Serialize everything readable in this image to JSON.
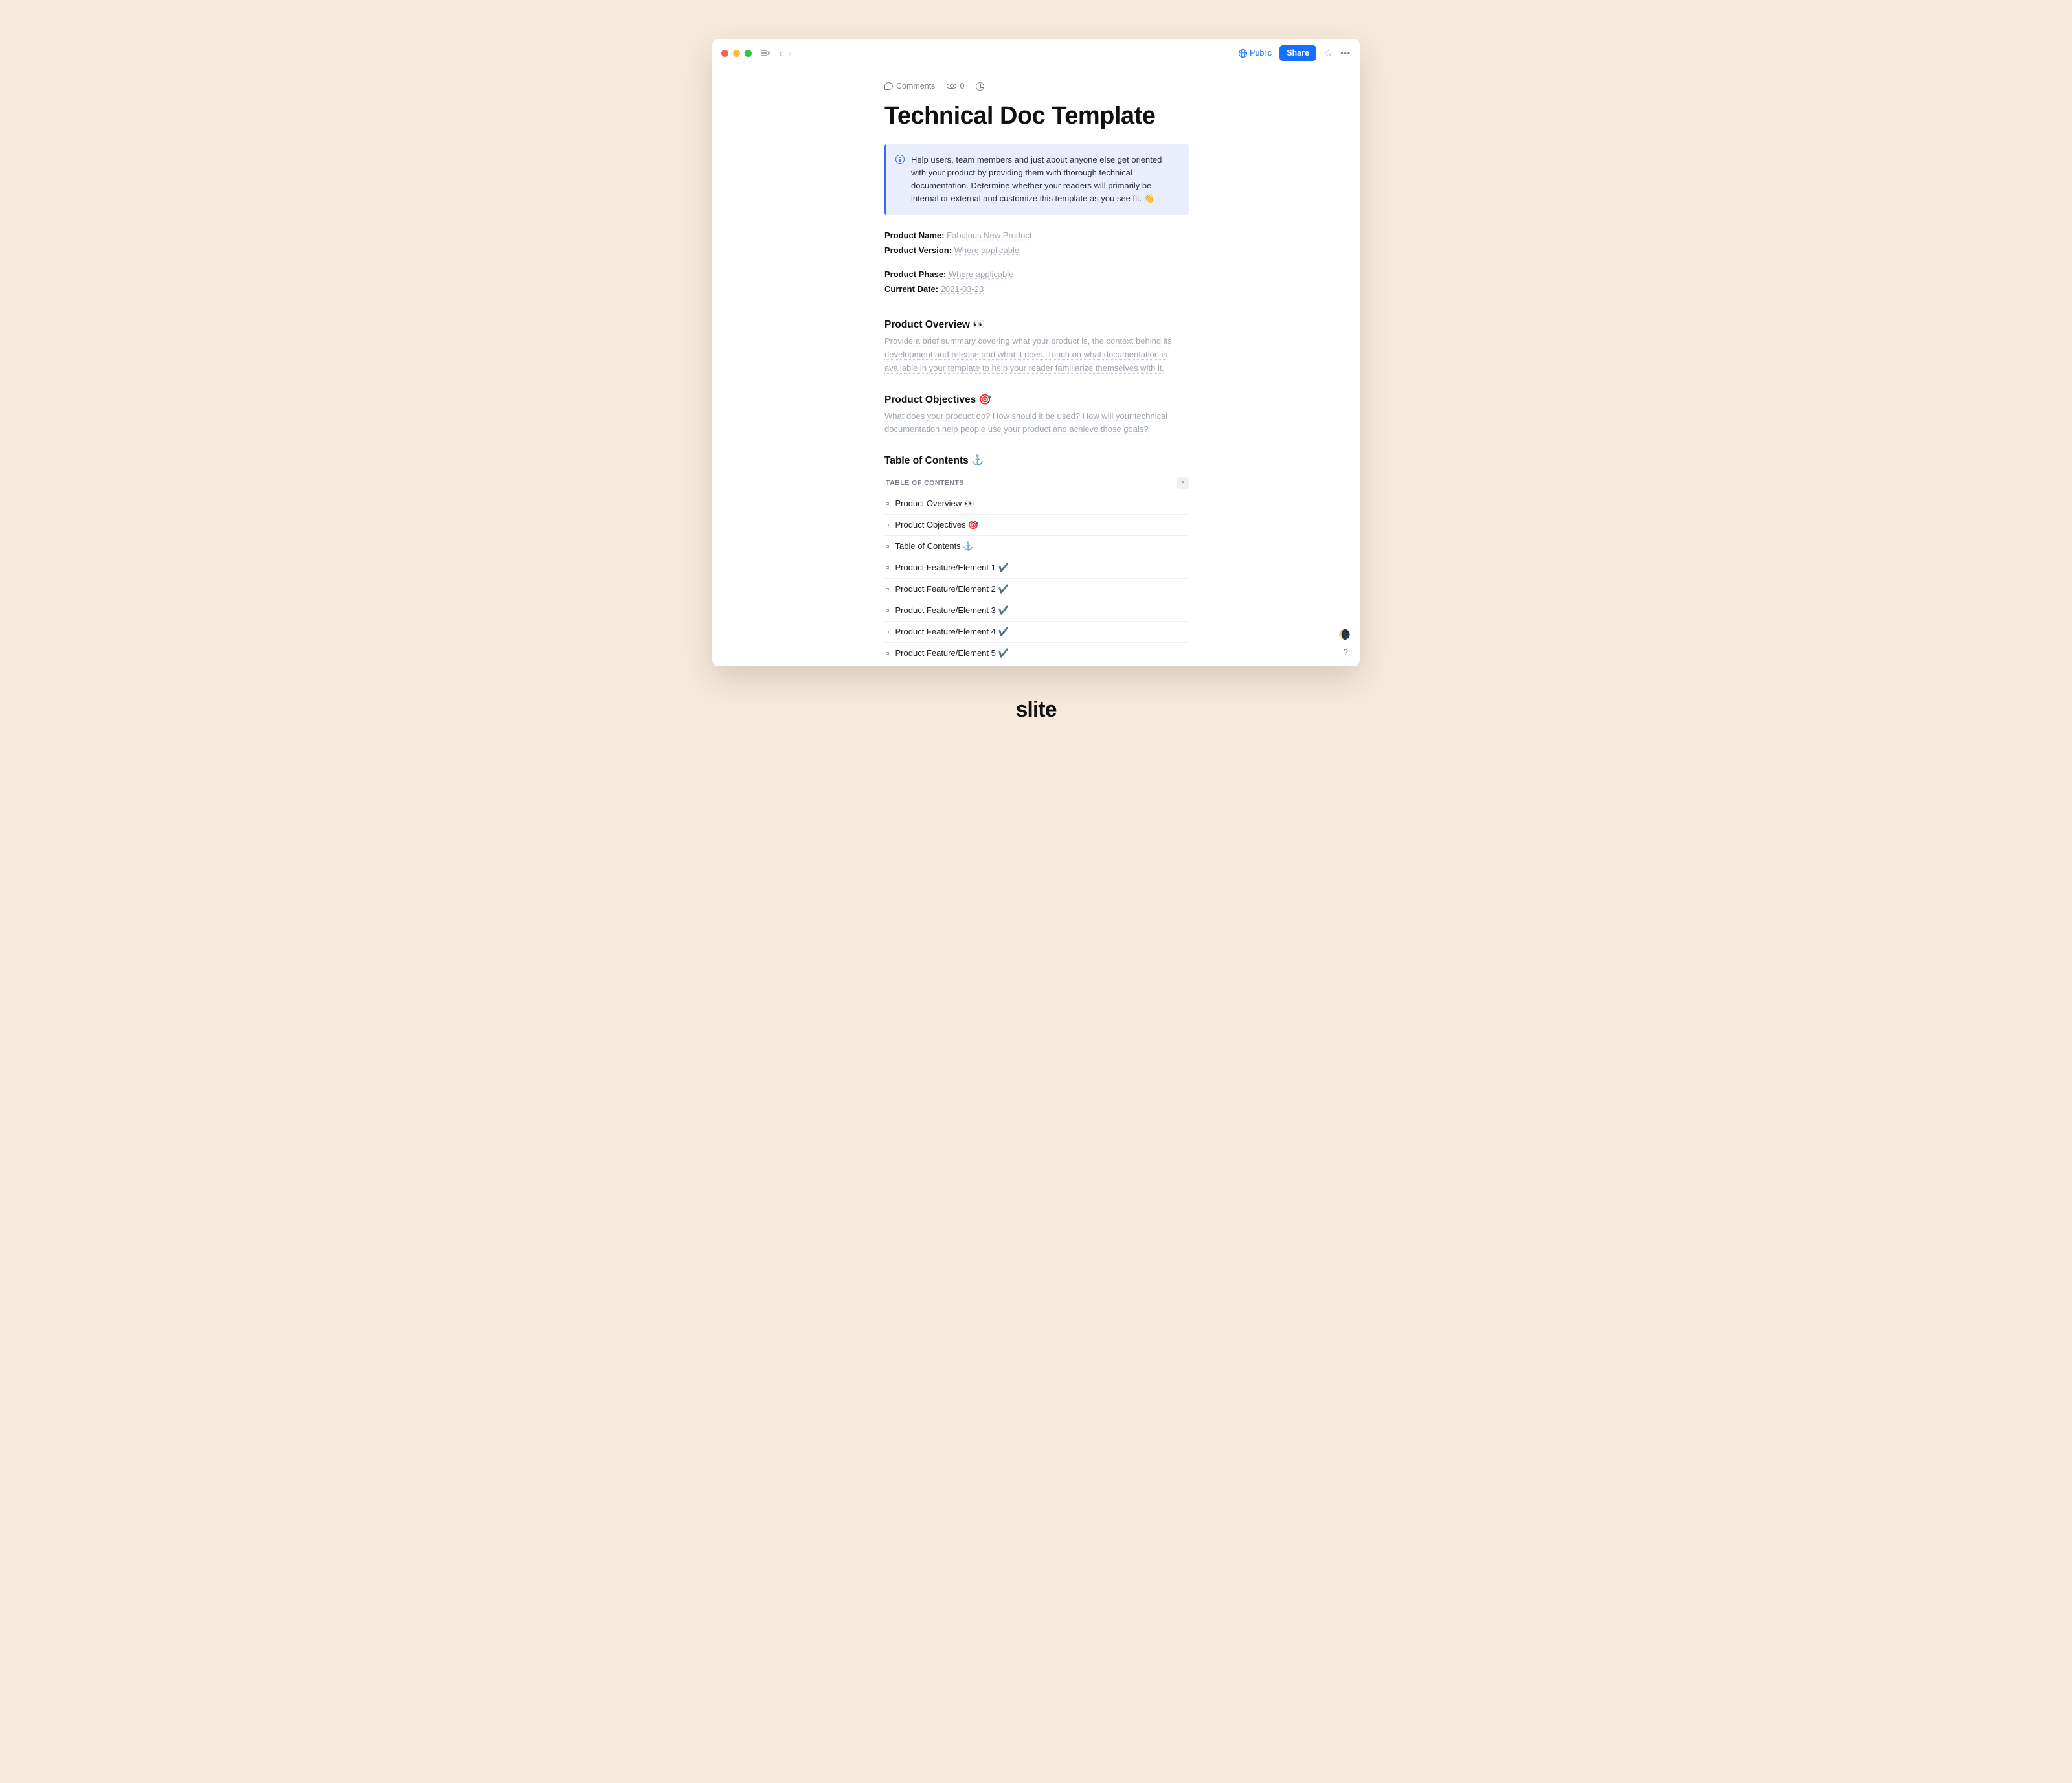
{
  "header": {
    "public_label": "Public",
    "share_label": "Share"
  },
  "meta": {
    "comments_label": "Comments",
    "views": "0"
  },
  "page_title": "Technical Doc Template",
  "callout": {
    "text": "Help users, team members and just about anyone else get oriented with your product by providing them with thorough technical documentation. Determine whether your readers will primarily be internal or external and customize this template as you see fit. 👋"
  },
  "fields": [
    {
      "label": "Product Name:",
      "value": "Fabulous New Product"
    },
    {
      "label": "Product Version:",
      "value": "Where applicable"
    }
  ],
  "fields2": [
    {
      "label": "Product Phase:",
      "value": "Where applicable"
    },
    {
      "label": "Current Date:",
      "value": "2021-03-23"
    }
  ],
  "sections": {
    "overview": {
      "title": "Product Overview 👀",
      "placeholder": "Provide a brief summary covering what your product is, the context behind its development and release and what it does. Touch on what documentation is available in your template to help your reader familiarize themselves with it."
    },
    "objectives": {
      "title": "Product Objectives 🎯",
      "placeholder": "What does your product do? How should it be used? How will your technical documentation help people use your product and achieve those goals?"
    },
    "toc_title": "Table of Contents ⚓"
  },
  "toc": {
    "header": "TABLE OF CONTENTS",
    "items": [
      "Product Overview 👀",
      "Product Objectives 🎯",
      "Table of Contents ⚓",
      "Product Feature/Element 1 ✔️",
      "Product Feature/Element 2 ✔️",
      "Product Feature/Element 3 ✔️",
      "Product Feature/Element 4 ✔️",
      "Product Feature/Element 5 ✔️"
    ]
  },
  "brand": "slite"
}
